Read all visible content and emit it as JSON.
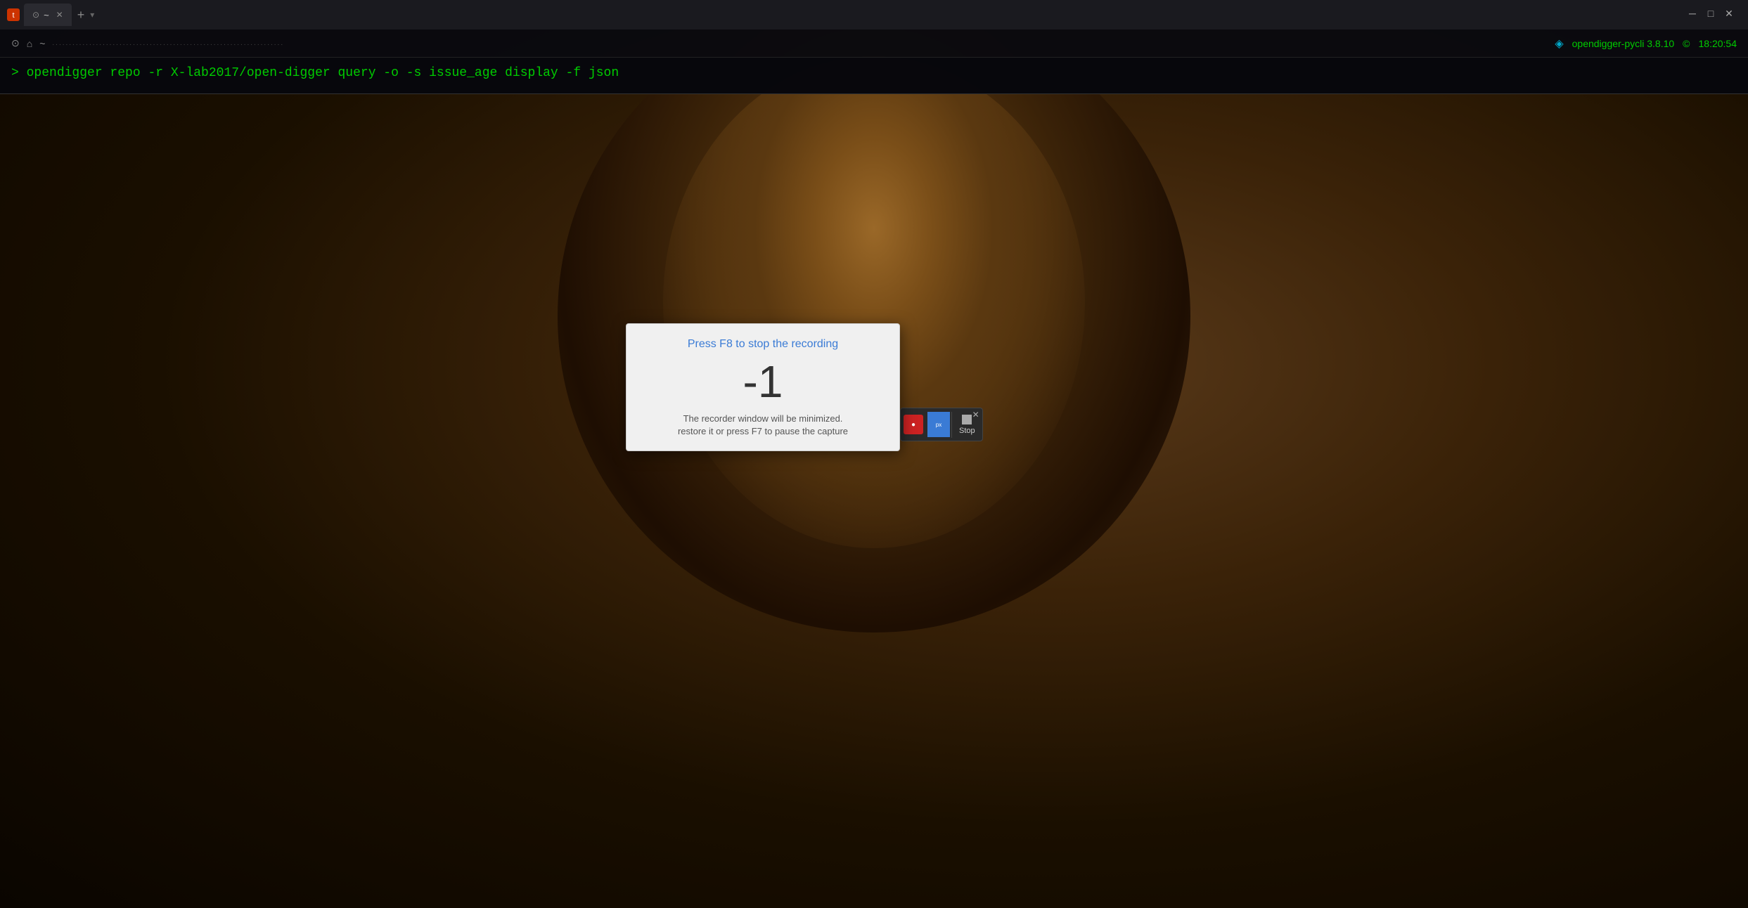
{
  "terminal": {
    "tab_label": "~",
    "tab_title": "~",
    "prompt_line1": "> ",
    "command_line1": "opendigger  repo  -r  X-lab2017/open-digger  query  -o  -s  issue_age  display  -f  json",
    "status_text": "opendigger-pycli 3.8.10",
    "clock": "18:20:54",
    "separator": "....................................................................."
  },
  "recording_dialog": {
    "title": "Press F8 to stop the recording",
    "countdown": "-1",
    "subtitle": "The recorder window will be minimized.\nrestore it or press F7 to pause the capture"
  },
  "mini_toolbar": {
    "stop_label": "Stop"
  },
  "win_controls": {
    "minimize": "─",
    "restore": "□",
    "close": "✕"
  }
}
